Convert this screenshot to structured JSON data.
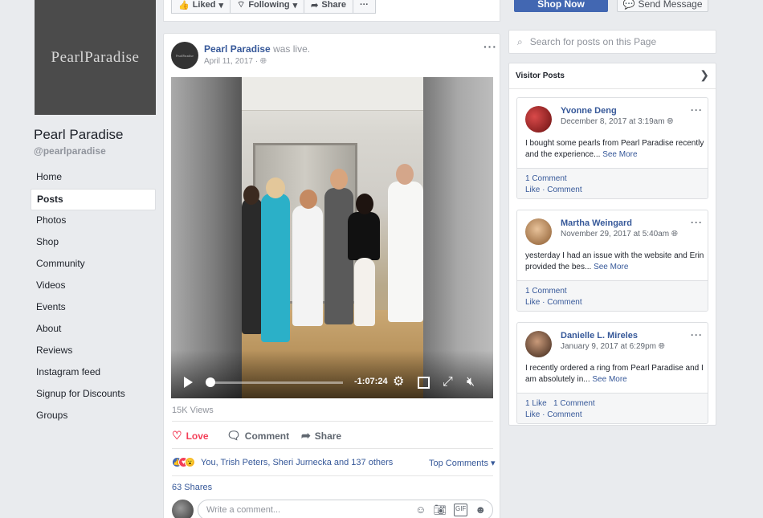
{
  "brand": {
    "logo_text": "PearlParadise"
  },
  "page": {
    "name": "Pearl Paradise",
    "handle": "@pearlparadise"
  },
  "nav": [
    "Home",
    "Posts",
    "Photos",
    "Shop",
    "Community",
    "Videos",
    "Events",
    "About",
    "Reviews",
    "Instagram feed",
    "Signup for Discounts",
    "Groups"
  ],
  "nav_active": "Posts",
  "toolbar": {
    "liked": "Liked",
    "following": "Following",
    "share": "Share",
    "more": "···"
  },
  "cta": {
    "shop_now": "Shop Now",
    "send_message": "Send Message"
  },
  "post": {
    "author": "Pearl Paradise",
    "status": "was live.",
    "date": "April 11, 2017 ·",
    "video": {
      "time_remaining": "-1:07:24",
      "progress_fraction": 0.02
    },
    "views": "15K Views",
    "actions": {
      "love": "Love",
      "comment": "Comment",
      "share": "Share"
    },
    "reactions_text": "You, Trish Peters, Sheri Jurnecka and 137 others",
    "top_comments": "Top Comments ▾",
    "shares": "63 Shares",
    "comment_placeholder": "Write a comment..."
  },
  "search": {
    "placeholder": "Search for posts on this Page"
  },
  "visitor_posts": {
    "title": "Visitor Posts",
    "items": [
      {
        "name": "Yvonne Deng",
        "date": "December 8, 2017 at 3:19am",
        "text": "I bought some pearls from Pearl Paradise recently and the experience...",
        "see_more": "See More",
        "counts": "1 Comment",
        "like": "Like",
        "comment": "Comment"
      },
      {
        "name": "Martha Weingard",
        "date": "November 29, 2017 at 5:40am",
        "text": "yesterday I had an issue with the website and Erin provided the bes...",
        "see_more": "See More",
        "counts": "1 Comment",
        "like": "Like",
        "comment": "Comment"
      },
      {
        "name": "Danielle L. Mireles",
        "date": "January 9, 2017 at 6:29pm",
        "text": "I recently ordered a ring from Pearl Paradise and I am absolutely in...",
        "see_more": "See More",
        "counts": "1 Like   1 Comment",
        "like": "Like",
        "comment": "Comment"
      }
    ]
  },
  "colors": {
    "link": "#365899",
    "brand_blue": "#4267b2",
    "love": "#f33e58",
    "bg": "#e9ebee"
  },
  "icons": [
    "thumbs-up-icon",
    "rss-icon",
    "share-arrow-icon",
    "messenger-icon",
    "globe-icon",
    "play-icon",
    "gear-icon",
    "fullscreen-icon",
    "mute-icon",
    "heart-icon",
    "comment-icon",
    "search-icon",
    "chevron-right-icon"
  ]
}
